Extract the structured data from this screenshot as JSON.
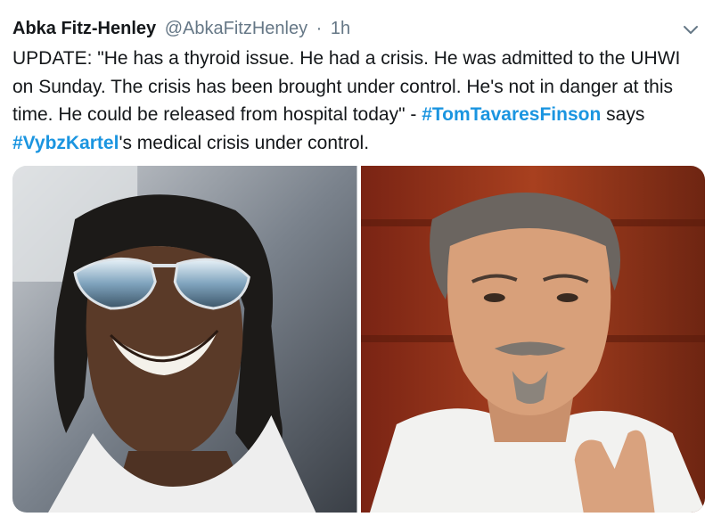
{
  "tweet": {
    "author_name": "Abka Fitz-Henley",
    "handle": "@AbkaFitzHenley",
    "separator": "·",
    "time": "1h",
    "text_segments": {
      "s1": "UPDATE: \"He has a thyroid issue. He had a crisis. He was admitted to the UHWI on Sunday. The crisis has been brought under control. He's not in danger at this time. He could be released from hospital today\" - ",
      "h1": "#TomTavaresFinson",
      "s2": " says ",
      "h2": "#VybzKartel",
      "s3": "'s medical crisis under control."
    },
    "menu_icon": "chevron-down-icon",
    "link_color": "#1b95e0"
  },
  "media": {
    "images": [
      {
        "name": "photo-left",
        "description_icon": "person-photo"
      },
      {
        "name": "photo-right",
        "description_icon": "person-photo"
      }
    ]
  }
}
